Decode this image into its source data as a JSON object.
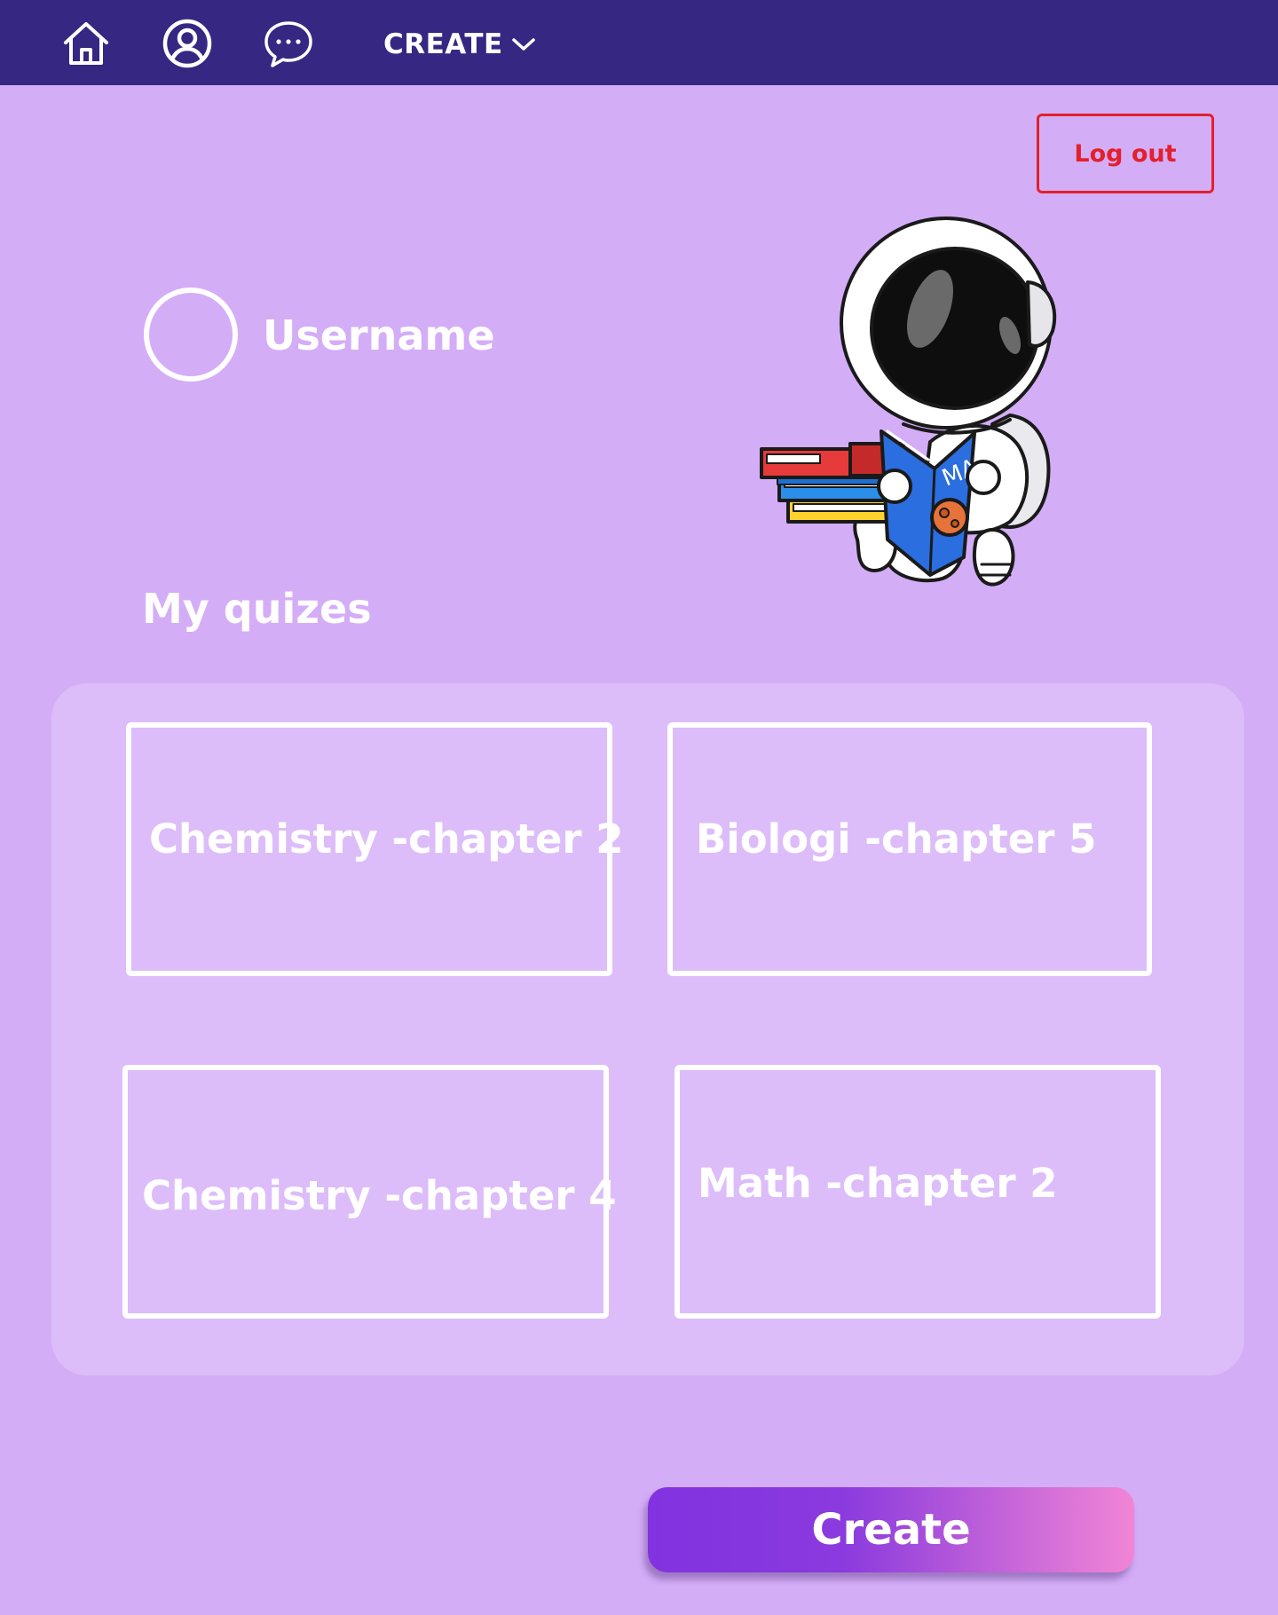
{
  "nav": {
    "icons": [
      "home-icon",
      "user-circle-icon",
      "chat-bubble-icon"
    ],
    "create_label": "CREATE",
    "create_icon": "chevron-down-icon"
  },
  "header": {
    "logout_label": "Log out"
  },
  "profile": {
    "username": "Username"
  },
  "illustration": {
    "subject": "astronaut-reading-book",
    "book_text": "MARS"
  },
  "quizzes": {
    "title": "My quizes",
    "items": [
      {
        "label": "Chemistry -chapter 2"
      },
      {
        "label": "Biologi -chapter 5"
      },
      {
        "label": "Chemistry -chapter 4"
      },
      {
        "label": "Math -chapter 2"
      }
    ]
  },
  "actions": {
    "create_label": "Create"
  },
  "colors": {
    "background": "#d4adf7",
    "navbar": "#362782",
    "panel": "#dcbdf9",
    "logout": "#e3202c",
    "create_gradient_start": "#8232df",
    "create_gradient_end": "#f185d5"
  }
}
